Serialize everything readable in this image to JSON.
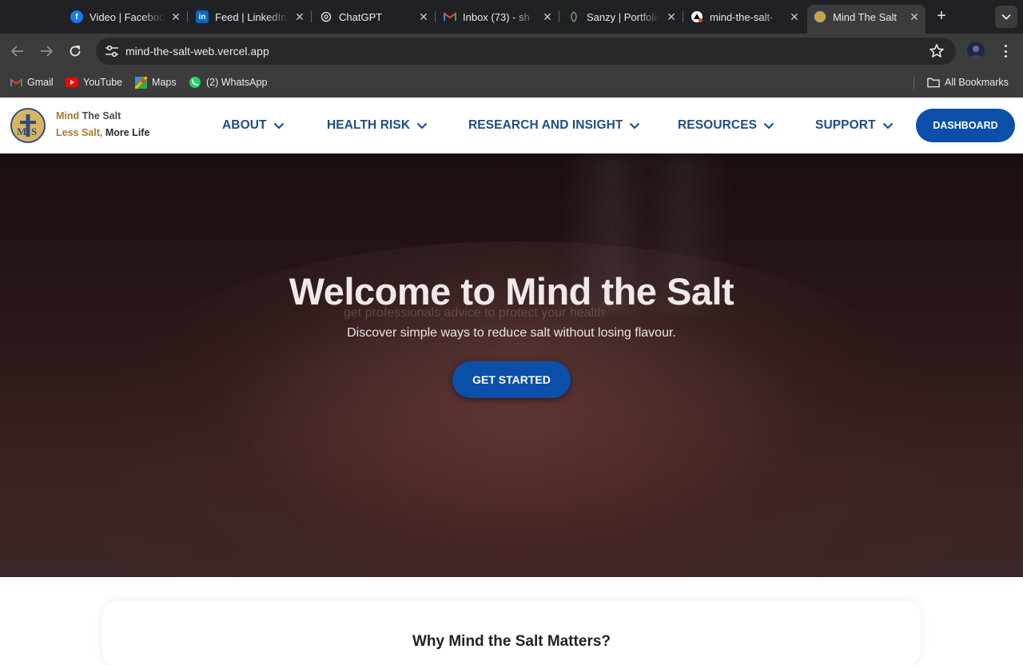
{
  "browser": {
    "tabs": [
      {
        "title": "Video | Facebook",
        "icon": "facebook-icon",
        "active": false
      },
      {
        "title": "Feed | LinkedIn",
        "icon": "linkedin-icon",
        "active": false
      },
      {
        "title": "ChatGPT",
        "icon": "chatgpt-icon",
        "active": false
      },
      {
        "title": "Inbox (73) - sh",
        "icon": "gmail-icon",
        "active": false
      },
      {
        "title": "Sanzy | Portfolio",
        "icon": "leaf-icon",
        "active": false
      },
      {
        "title": "mind-the-salt-",
        "icon": "vercel-icon",
        "active": false
      },
      {
        "title": "Mind The Salt",
        "icon": "site-logo-icon",
        "active": true
      }
    ],
    "url": "mind-the-salt-web.vercel.app",
    "bookmarks": [
      {
        "label": "Gmail",
        "icon": "gmail-icon"
      },
      {
        "label": "YouTube",
        "icon": "youtube-icon"
      },
      {
        "label": "Maps",
        "icon": "maps-icon"
      },
      {
        "label": "(2) WhatsApp",
        "icon": "whatsapp-icon"
      }
    ],
    "all_bookmarks": "All Bookmarks"
  },
  "site": {
    "brand_line1_a": "Mind ",
    "brand_line1_b": "The Salt",
    "brand_line2_a": "Less Salt, ",
    "brand_line2_b": "More Life",
    "nav": [
      {
        "label": "ABOUT"
      },
      {
        "label": "HEALTH RISK"
      },
      {
        "label": "RESEARCH AND INSIGHT"
      },
      {
        "label": "RESOURCES"
      },
      {
        "label": "SUPPORT"
      }
    ],
    "dashboard_label": "DASHBOARD",
    "colors": {
      "primary": "#0b4fa8",
      "nav_text": "#1d4e89",
      "brand_gold": "#a8782b"
    }
  },
  "hero": {
    "title": "Welcome to Mind the Salt",
    "ghost_text": "get professionals advice to protect your health",
    "subtitle": "Discover simple ways to reduce salt without losing flavour.",
    "cta_label": "GET STARTED"
  },
  "section": {
    "title": "Why Mind the Salt Matters?"
  }
}
